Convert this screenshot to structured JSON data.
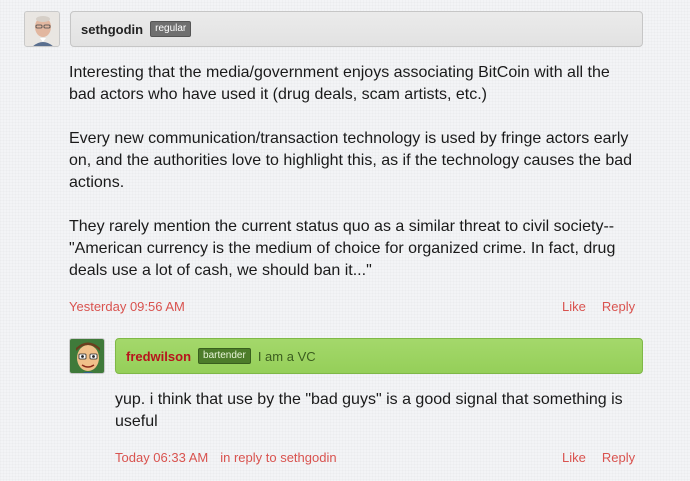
{
  "comments": [
    {
      "username": "sethgodin",
      "badge": "regular",
      "paragraphs": [
        "Interesting that the media/government enjoys associating BitCoin with all the bad actors who have used it (drug deals, scam artists, etc.)",
        "Every new communication/transaction technology is used by fringe actors early on, and the authorities love to highlight this, as if the technology causes the bad actions.",
        "They rarely mention the current status quo as a similar threat to civil society--\"American currency is the medium of choice for organized crime. In fact, drug deals use a lot of cash, we should ban it...\""
      ],
      "timestamp": "Yesterday 09:56 AM",
      "like_label": "Like",
      "reply_label": "Reply"
    },
    {
      "username": "fredwilson",
      "badge": "bartender",
      "tagline": "I am a VC",
      "paragraphs": [
        "yup. i think that use by the \"bad guys\" is a good signal that something is useful"
      ],
      "timestamp": "Today 06:33 AM",
      "in_reply_to": "in reply to sethgodin",
      "like_label": "Like",
      "reply_label": "Reply"
    }
  ],
  "colors": {
    "link_red": "#d9534f",
    "fred_green": "#9bd35f",
    "fred_name": "#b7141d"
  }
}
